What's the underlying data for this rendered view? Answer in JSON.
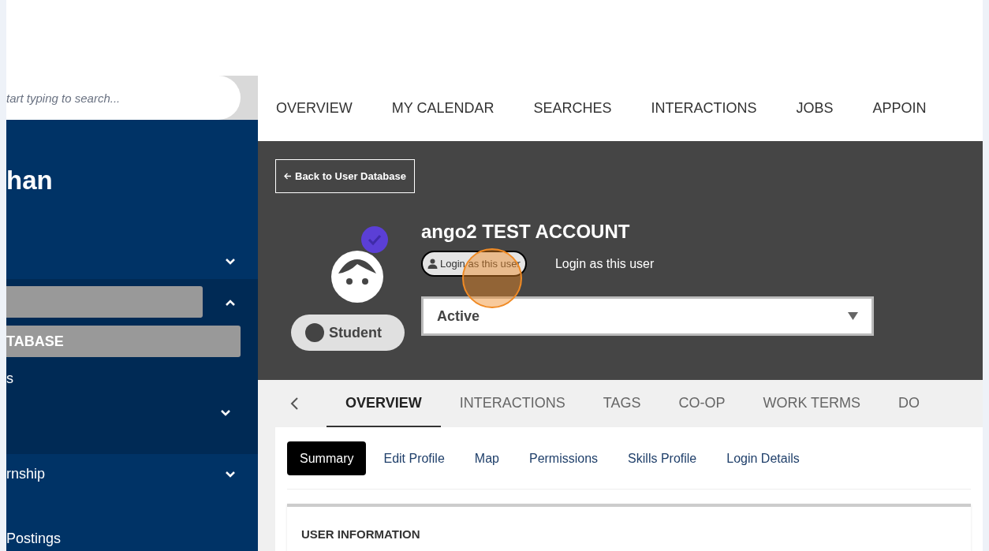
{
  "search": {
    "placeholder": "tart typing to search..."
  },
  "top_nav": [
    {
      "label": "OVERVIEW"
    },
    {
      "label": "MY CALENDAR"
    },
    {
      "label": "SEARCHES"
    },
    {
      "label": "INTERACTIONS"
    },
    {
      "label": "JOBS"
    },
    {
      "label": "APPOIN"
    }
  ],
  "sidebar": {
    "user_name": "han",
    "items": [
      {
        "kind": "group",
        "expanded": false
      },
      {
        "kind": "group",
        "expanded": true,
        "children": [
          {
            "kind": "link",
            "label": "TABASE",
            "selected": true
          },
          {
            "kind": "link",
            "label": "s",
            "selected": false
          },
          {
            "kind": "group",
            "expanded": false
          }
        ]
      },
      {
        "kind": "group",
        "label": "rnship",
        "expanded": false
      },
      {
        "kind": "link",
        "label": "Postings",
        "selected": false
      }
    ]
  },
  "header": {
    "back_button": "Back to User Database",
    "name": "ango2 TEST ACCOUNT",
    "login_button": "Login as this user",
    "login_note": "Login as this user",
    "role": "Student",
    "status": "Active"
  },
  "tabs": [
    {
      "label": "OVERVIEW",
      "selected": true
    },
    {
      "label": "INTERACTIONS",
      "selected": false
    },
    {
      "label": "TAGS",
      "selected": false
    },
    {
      "label": "CO-OP",
      "selected": false
    },
    {
      "label": "WORK TERMS",
      "selected": false
    },
    {
      "label": "DO",
      "selected": false
    }
  ],
  "subtabs": [
    {
      "label": "Summary",
      "selected": true
    },
    {
      "label": "Edit Profile",
      "selected": false
    },
    {
      "label": "Map",
      "selected": false
    },
    {
      "label": "Permissions",
      "selected": false
    },
    {
      "label": "Skills Profile",
      "selected": false
    },
    {
      "label": "Login Details",
      "selected": false
    }
  ],
  "section_title": "USER INFORMATION"
}
